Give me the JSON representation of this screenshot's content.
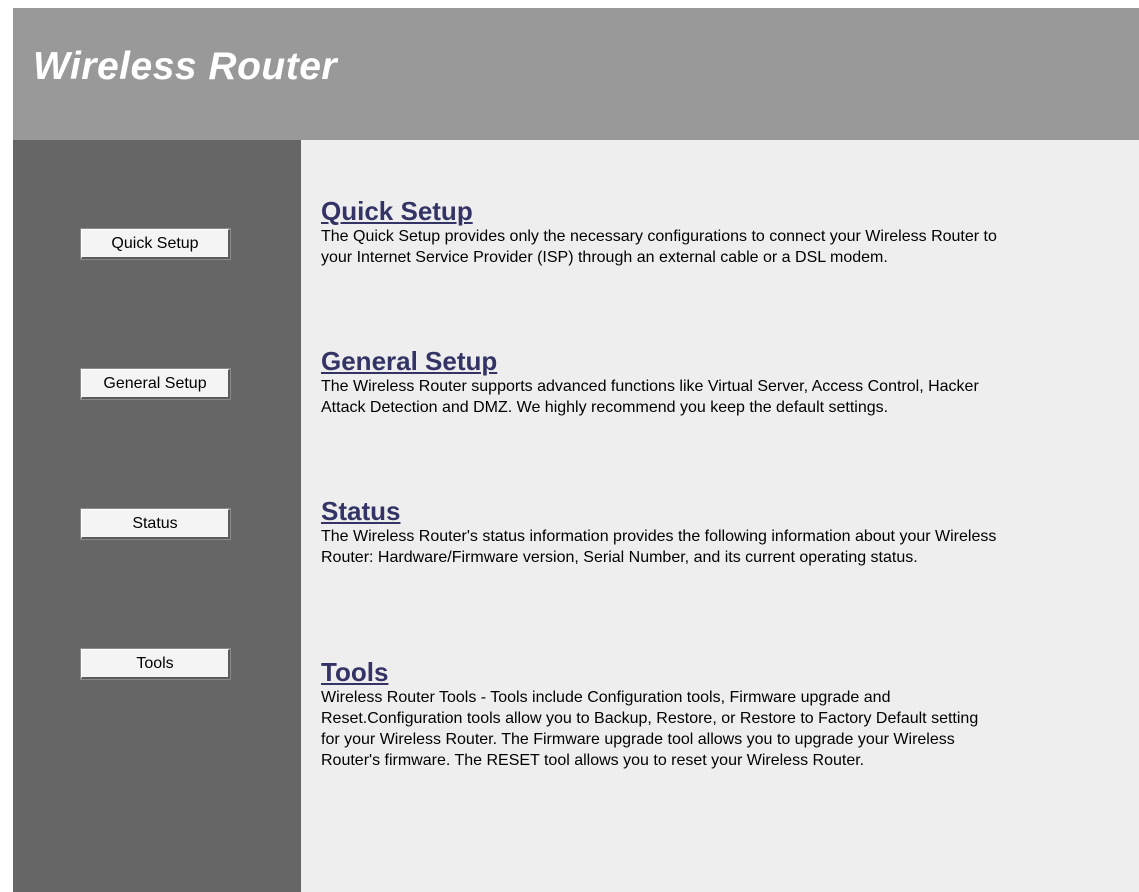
{
  "header": {
    "title": "Wireless Router"
  },
  "sidebar": {
    "buttons": [
      {
        "label": "Quick Setup"
      },
      {
        "label": "General Setup"
      },
      {
        "label": "Status"
      },
      {
        "label": "Tools"
      }
    ]
  },
  "main": {
    "sections": [
      {
        "title": "Quick Setup",
        "description": "The Quick Setup provides only the necessary configurations to connect your Wireless Router to your Internet Service Provider (ISP) through an external cable or a DSL modem."
      },
      {
        "title": "General Setup",
        "description": "The Wireless Router supports advanced functions like Virtual Server, Access Control, Hacker Attack Detection and DMZ. We highly recommend you keep the default settings."
      },
      {
        "title": "Status",
        "description": "The Wireless Router's status information provides the following information about your Wireless Router: Hardware/Firmware version, Serial Number, and its current operating status."
      },
      {
        "title": "Tools",
        "description": "Wireless Router Tools - Tools include Configuration tools, Firmware upgrade and Reset.Configuration tools allow you to Backup, Restore, or Restore to Factory Default setting for your Wireless Router. The Firmware upgrade tool allows you to upgrade your Wireless Router's firmware. The RESET tool allows you to reset your Wireless Router."
      }
    ]
  },
  "colors": {
    "header_bg": "#999999",
    "sidebar_bg": "#666666",
    "main_bg": "#eeeeee",
    "link_color": "#333366"
  }
}
